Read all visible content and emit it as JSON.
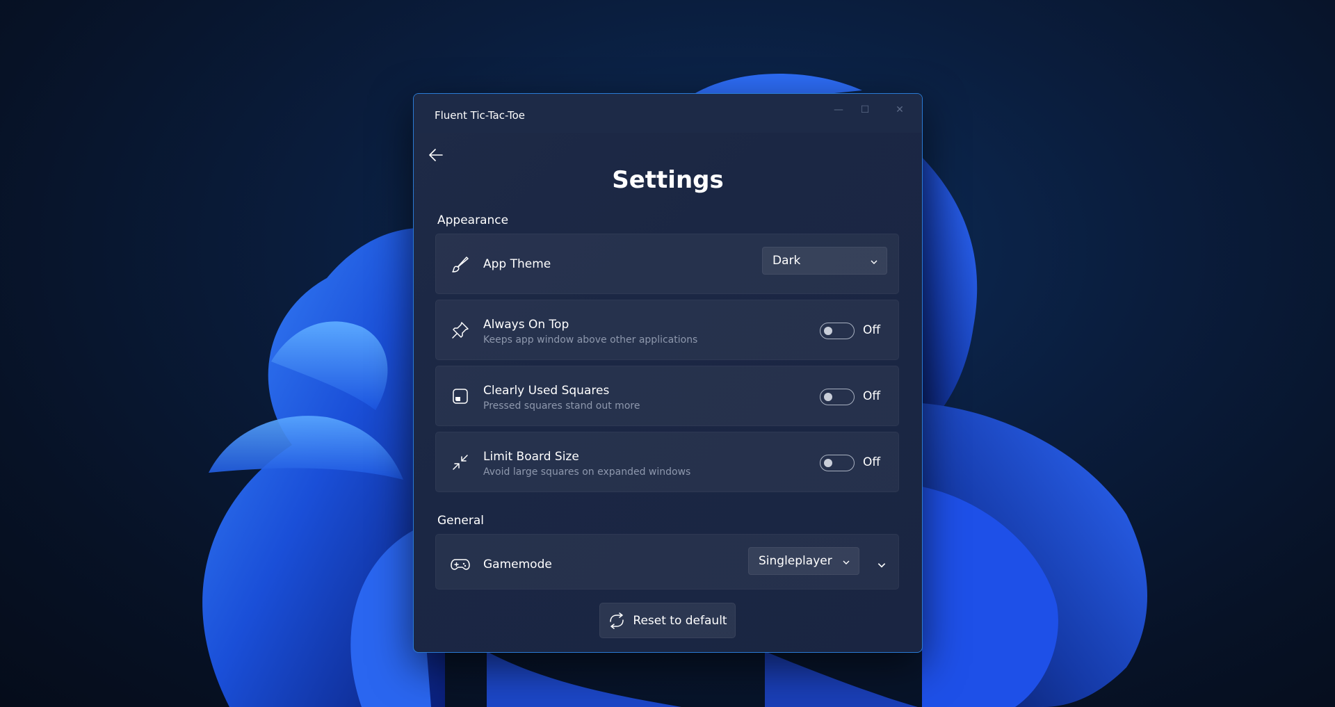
{
  "window": {
    "title": "Fluent Tic-Tac-Toe",
    "caption": {
      "minimize": "—",
      "maximize": "☐",
      "close": "✕"
    }
  },
  "page": {
    "title": "Settings"
  },
  "sections": {
    "appearance": "Appearance",
    "general": "General"
  },
  "settings": {
    "app_theme": {
      "title": "App Theme",
      "value": "Dark",
      "icon": "brush-icon"
    },
    "always_on_top": {
      "title": "Always On Top",
      "description": "Keeps app window above other applications",
      "state": "Off",
      "icon": "pin-icon"
    },
    "clearly_used_squares": {
      "title": "Clearly Used Squares",
      "description": "Pressed squares stand out more",
      "state": "Off",
      "icon": "square-icon"
    },
    "limit_board_size": {
      "title": "Limit Board Size",
      "description": "Avoid large squares on expanded windows",
      "state": "Off",
      "icon": "shrink-icon"
    },
    "gamemode": {
      "title": "Gamemode",
      "value": "Singleplayer",
      "icon": "gamepad-icon"
    }
  },
  "actions": {
    "reset_label": "Reset to default"
  },
  "colors": {
    "window_border": "#2a7bd6",
    "window_bg": "#1b2744",
    "card_bg": "#253150",
    "secondary_text": "#8e98ad"
  }
}
